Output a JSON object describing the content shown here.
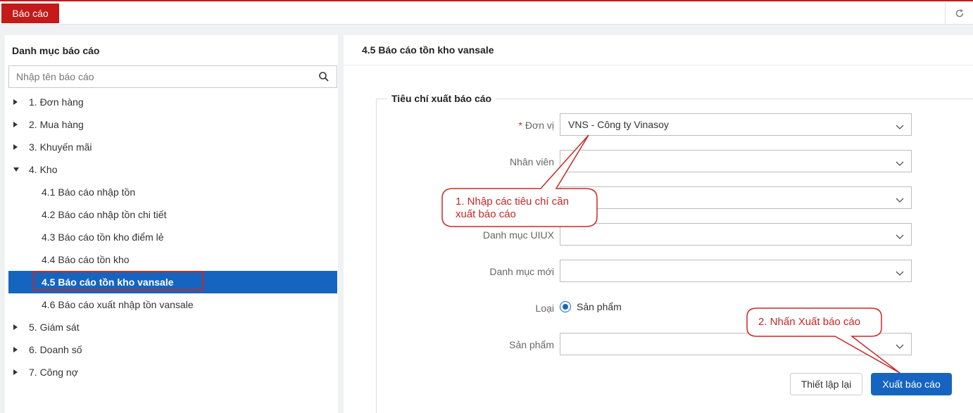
{
  "topbar": {
    "tab_label": "Báo cáo",
    "refresh_icon": "refresh-icon"
  },
  "left": {
    "title": "Danh mục báo cáo",
    "search_placeholder": "Nhập tên báo cáo",
    "search_icon": "search-icon",
    "items": [
      {
        "label": "1. Đơn hàng"
      },
      {
        "label": "2. Mua hàng"
      },
      {
        "label": "3. Khuyến mãi"
      },
      {
        "label": "4. Kho"
      },
      {
        "label": "4.1 Báo cáo nhập tồn"
      },
      {
        "label": "4.2 Báo cáo nhập tồn chi tiết"
      },
      {
        "label": "4.3 Báo cáo tồn kho điểm lẻ"
      },
      {
        "label": "4.4 Báo cáo tồn kho"
      },
      {
        "label": "4.5 Báo cáo tồn kho vansale"
      },
      {
        "label": "4.6 Báo cáo xuất nhập tồn vansale"
      },
      {
        "label": "5. Giám sát"
      },
      {
        "label": "6. Doanh số"
      },
      {
        "label": "7. Công nợ"
      }
    ]
  },
  "main": {
    "title": "4.5 Báo cáo tồn kho vansale",
    "legend": "Tiêu chí xuất báo cáo",
    "required_mark": "*",
    "fields": [
      {
        "label": "Đơn vị",
        "value": "VNS - Công ty Vinasoy"
      },
      {
        "label": "Nhân viên",
        "value": ""
      },
      {
        "label": "",
        "value": ""
      },
      {
        "label": "Danh mục UIUX",
        "value": ""
      },
      {
        "label": "Danh mục mới",
        "value": ""
      },
      {
        "label": "Sản phẩm",
        "value": ""
      }
    ],
    "type_label": "Loại",
    "type_option": "Sản phẩm",
    "reset_label": "Thiết lập lại",
    "export_label": "Xuất báo cáo"
  },
  "callouts": {
    "step1_line1": "1. Nhập các tiêu chí cần",
    "step1_line2": "xuất báo cáo",
    "step2": "2. Nhấn Xuất báo cáo",
    "color": "#c62828"
  },
  "colors": {
    "brand_red": "#c41a1a",
    "selected_blue": "#1565c0"
  }
}
